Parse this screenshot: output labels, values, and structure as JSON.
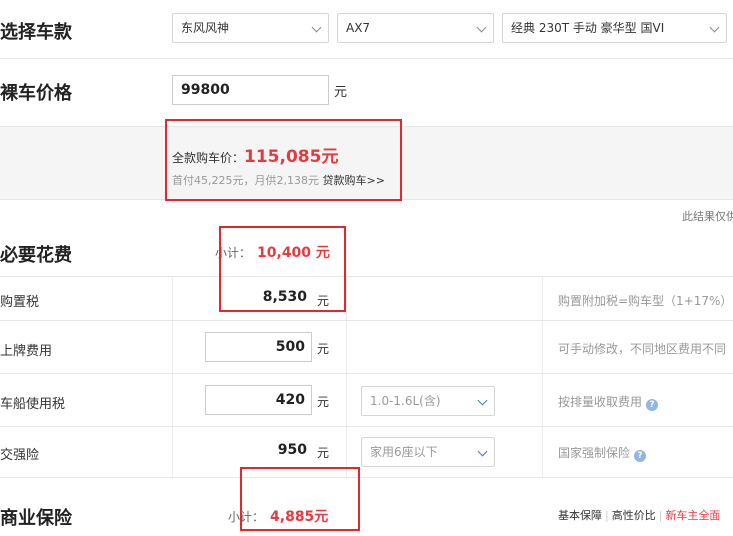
{
  "select_car": {
    "title": "选择车款",
    "brand": "东风风神",
    "model": "AX7",
    "trim": "经典 230T 手动 豪华型 国VI"
  },
  "bare_price": {
    "title": "裸车价格",
    "value": "99800",
    "unit": "元"
  },
  "summary": {
    "full_label": "全款购车价：",
    "full_value": "115,085元",
    "loan_text": "首付45,225元，月供2,138元",
    "loan_link": "贷款购车>>",
    "disclaimer": "此结果仅供"
  },
  "required_fees": {
    "title": "必要花费",
    "subtotal_label": "小计：",
    "subtotal_value": "10,400 元",
    "rows": [
      {
        "label": "购置税",
        "value": "8,530",
        "unit": "元",
        "note": "购置附加税=购车型（1+17%）"
      },
      {
        "label": "上牌费用",
        "value": "500",
        "unit": "元",
        "note": "可手动修改，不同地区费用不同"
      },
      {
        "label": "车船使用税",
        "value": "420",
        "unit": "元",
        "select": "1.0-1.6L(含)",
        "note": "按排量收取费用"
      },
      {
        "label": "交强险",
        "value": "950",
        "unit": "元",
        "select": "家用6座以下",
        "note": "国家强制保险"
      }
    ]
  },
  "commercial_insurance": {
    "title": "商业保险",
    "subtotal_label": "小计：",
    "subtotal_value": "4,885元",
    "tabs": [
      "基本保障",
      "高性价比",
      "新车主全面"
    ]
  },
  "colors": {
    "accent_red": "#e8393e",
    "box_red": "#e0282e",
    "help_blue": "#8fb6e6"
  }
}
